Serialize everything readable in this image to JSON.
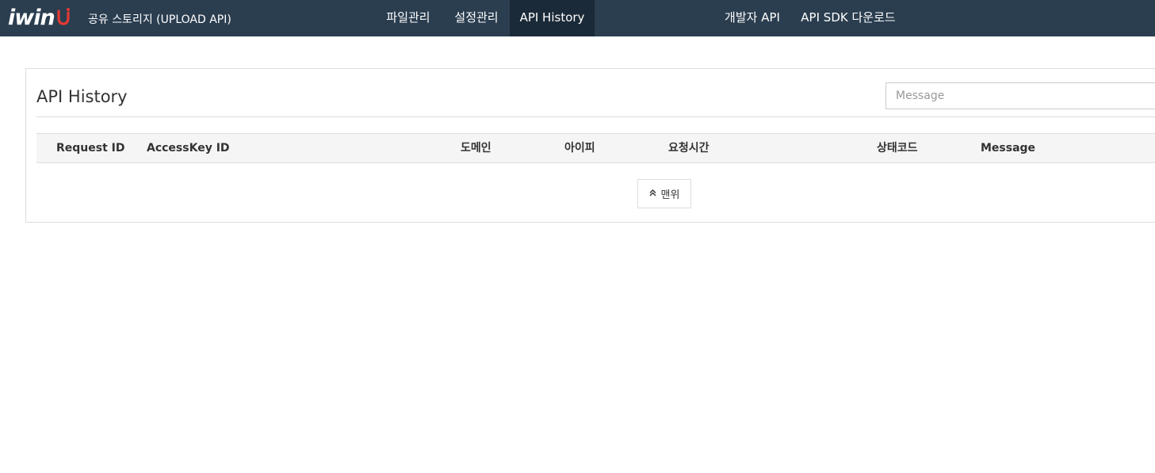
{
  "header": {
    "logo_text": "iwin",
    "app_title": "공유 스토리지 (UPLOAD API)",
    "brand_colors": {
      "bar": "#2b3e50",
      "active": "#1b2a38",
      "smile": "#e53935"
    },
    "nav": [
      {
        "label": "파일관리",
        "active": false
      },
      {
        "label": "설정관리",
        "active": false
      },
      {
        "label": "API History",
        "active": true
      },
      {
        "label": "개발자 API",
        "active": false
      },
      {
        "label": "API SDK 다운로드",
        "active": false
      }
    ]
  },
  "panel": {
    "title": "API History",
    "search_placeholder": "Message",
    "columns": [
      "Request ID",
      "AccessKey ID",
      "도메인",
      "아이피",
      "요청시간",
      "상태코드",
      "Message"
    ],
    "rows": [],
    "top_button_label": "맨위",
    "top_button_icon": "double-chevron-up-icon"
  }
}
